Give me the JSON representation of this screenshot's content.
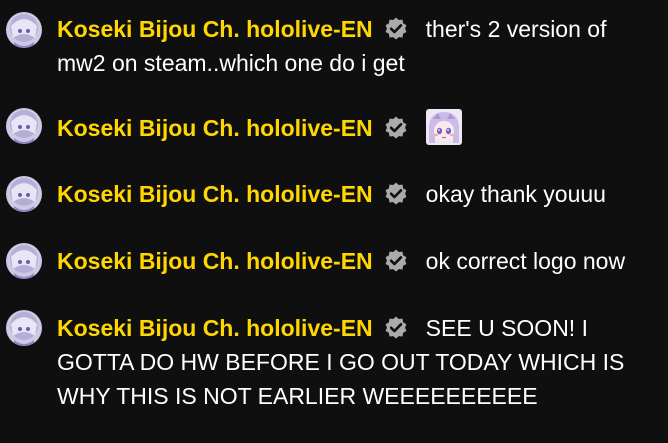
{
  "colors": {
    "background": "#0f0f0f",
    "author": "#ffd600",
    "message": "#ffffff",
    "badge": "#aaaaaa"
  },
  "messages": [
    {
      "author": "Koseki Bijou Ch. hololive-EN",
      "badge": "verified-check-icon",
      "text": "ther's 2 version of mw2 on steam..which one do i get"
    },
    {
      "author": "Koseki Bijou Ch. hololive-EN",
      "badge": "verified-check-icon",
      "emote": "bijou-face-emote-icon"
    },
    {
      "author": "Koseki Bijou Ch. hololive-EN",
      "badge": "verified-check-icon",
      "text": "okay thank youuu"
    },
    {
      "author": "Koseki Bijou Ch. hololive-EN",
      "badge": "verified-check-icon",
      "text": "ok correct logo now"
    },
    {
      "author": "Koseki Bijou Ch. hololive-EN",
      "badge": "verified-check-icon",
      "text": "SEE U SOON! I GOTTA DO HW BEFORE I GO OUT TODAY WHICH IS WHY THIS IS NOT EARLIER WEEEEEEEEEE"
    }
  ]
}
